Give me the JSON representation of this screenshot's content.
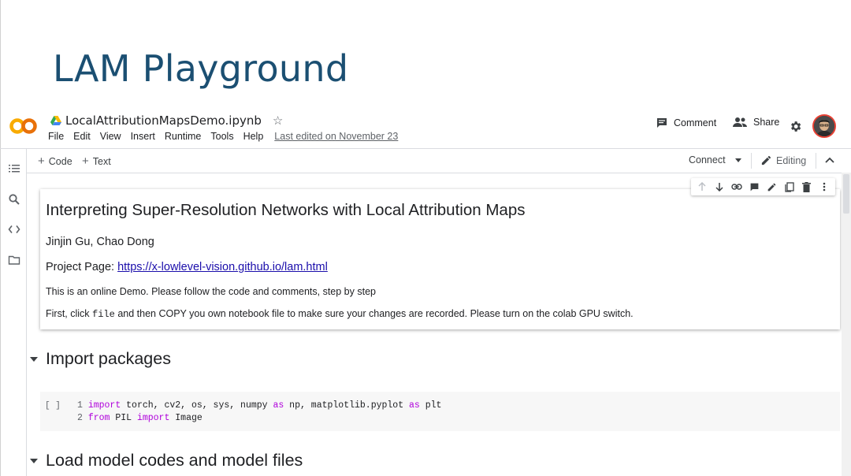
{
  "slide": {
    "title": "LAM Playground"
  },
  "header": {
    "notebook_name": "LocalAttributionMapsDemo.ipynb",
    "menu": [
      "File",
      "Edit",
      "View",
      "Insert",
      "Runtime",
      "Tools",
      "Help"
    ],
    "last_edited": "Last edited on November 23",
    "comment_label": "Comment",
    "share_label": "Share"
  },
  "toolbar": {
    "code_label": "Code",
    "text_label": "Text",
    "connect_label": "Connect",
    "editing_label": "Editing"
  },
  "text_cell": {
    "heading": "Interpreting Super-Resolution Networks with Local Attribution Maps",
    "authors": "Jinjin Gu, Chao Dong",
    "project_prefix": "Project Page: ",
    "project_link": "https://x-lowlevel-vision.github.io/lam.html",
    "intro": "This is an online Demo. Please follow the code and comments, step by step",
    "instr_prefix": "First, click ",
    "instr_code": "file",
    "instr_suffix": " and then COPY you own notebook file to make sure your changes are recorded. Please turn on the colab GPU switch."
  },
  "sections": {
    "import_title": "Import packages",
    "load_title": "Load model codes and model files"
  },
  "code_cell": {
    "run_indicator": "[ ]",
    "line1_no": "1",
    "line1_kw1": "import",
    "line1_mid": " torch, cv2, os, sys, numpy ",
    "line1_kw2": "as",
    "line1_mid2": " np, matplotlib.pyplot ",
    "line1_kw3": "as",
    "line1_end": " plt",
    "line2_no": "2",
    "line2_kw1": "from",
    "line2_mid": " PIL ",
    "line2_kw2": "import",
    "line2_end": " Image"
  },
  "colors": {
    "title_blue": "#1b4f72",
    "link": "#1a0dab",
    "keyword": "#af00db",
    "colab_orange": "#f9ab00"
  }
}
